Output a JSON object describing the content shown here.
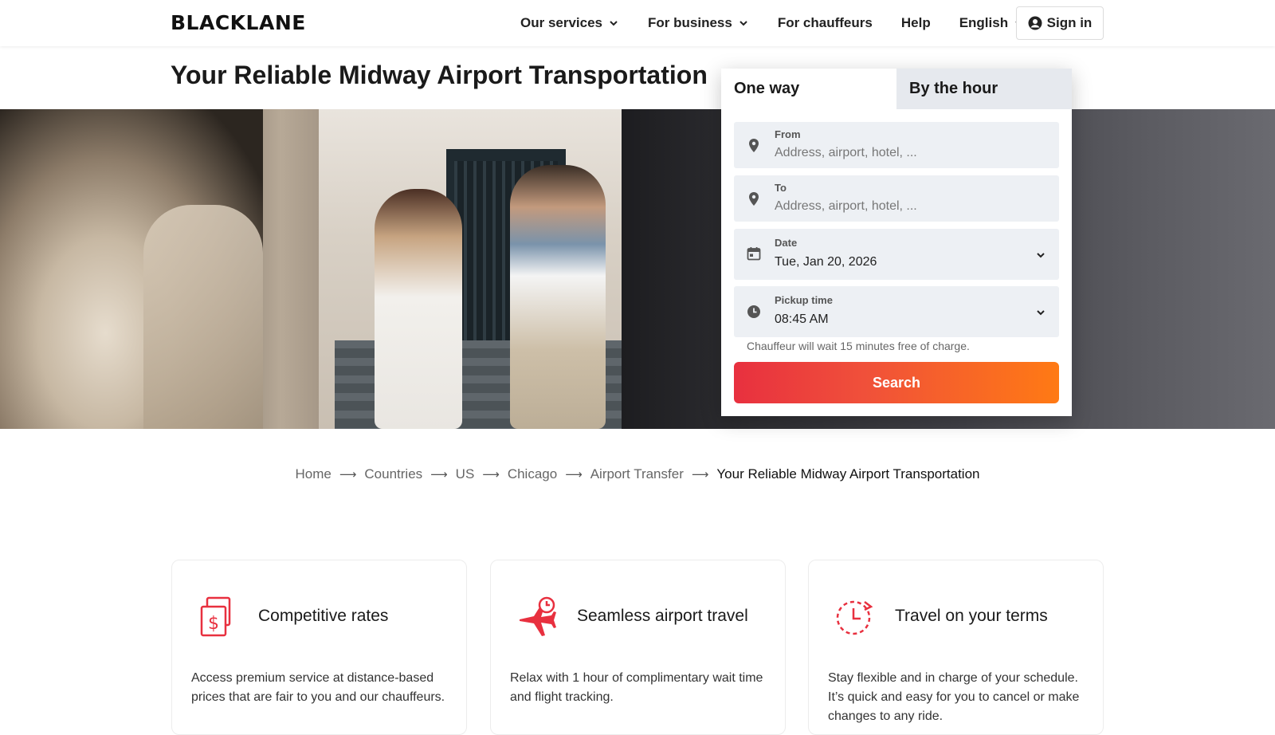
{
  "header": {
    "logo": "BLACKLANE",
    "nav": [
      {
        "label": "Our services",
        "has_dropdown": true
      },
      {
        "label": "For business",
        "has_dropdown": true
      },
      {
        "label": "For chauffeurs",
        "has_dropdown": false
      },
      {
        "label": "Help",
        "has_dropdown": false
      },
      {
        "label": "English",
        "has_dropdown": true
      }
    ],
    "signin_label": "Sign in"
  },
  "page_title": "Your Reliable Midway Airport Transportation",
  "booking": {
    "tabs": [
      {
        "label": "One way",
        "active": true
      },
      {
        "label": "By the hour",
        "active": false
      }
    ],
    "from": {
      "label": "From",
      "placeholder": "Address, airport, hotel, ..."
    },
    "to": {
      "label": "To",
      "placeholder": "Address, airport, hotel, ..."
    },
    "date": {
      "label": "Date",
      "value": "Tue, Jan 20, 2026"
    },
    "pickup_time": {
      "label": "Pickup time",
      "value": "08:45 AM"
    },
    "note": "Chauffeur will wait 15 minutes free of charge.",
    "search_label": "Search"
  },
  "breadcrumb": [
    "Home",
    "Countries",
    "US",
    "Chicago",
    "Airport Transfer",
    "Your Reliable Midway Airport Transportation"
  ],
  "features": [
    {
      "icon": "dollar-documents-icon",
      "title": "Competitive rates",
      "text": "Access premium service at distance-based prices that are fair to you and our chauffeurs."
    },
    {
      "icon": "airplane-clock-icon",
      "title": "Seamless airport travel",
      "text": "Relax with 1 hour of complimentary wait time and flight tracking."
    },
    {
      "icon": "clock-refresh-icon",
      "title": "Travel on your terms",
      "text": "Stay flexible and in charge of your schedule. It’s quick and easy for you to cancel or make changes to any ride."
    }
  ],
  "colors": {
    "accent_start": "#e8303f",
    "accent_end": "#ff7a14",
    "icon_red": "#e8303f"
  }
}
